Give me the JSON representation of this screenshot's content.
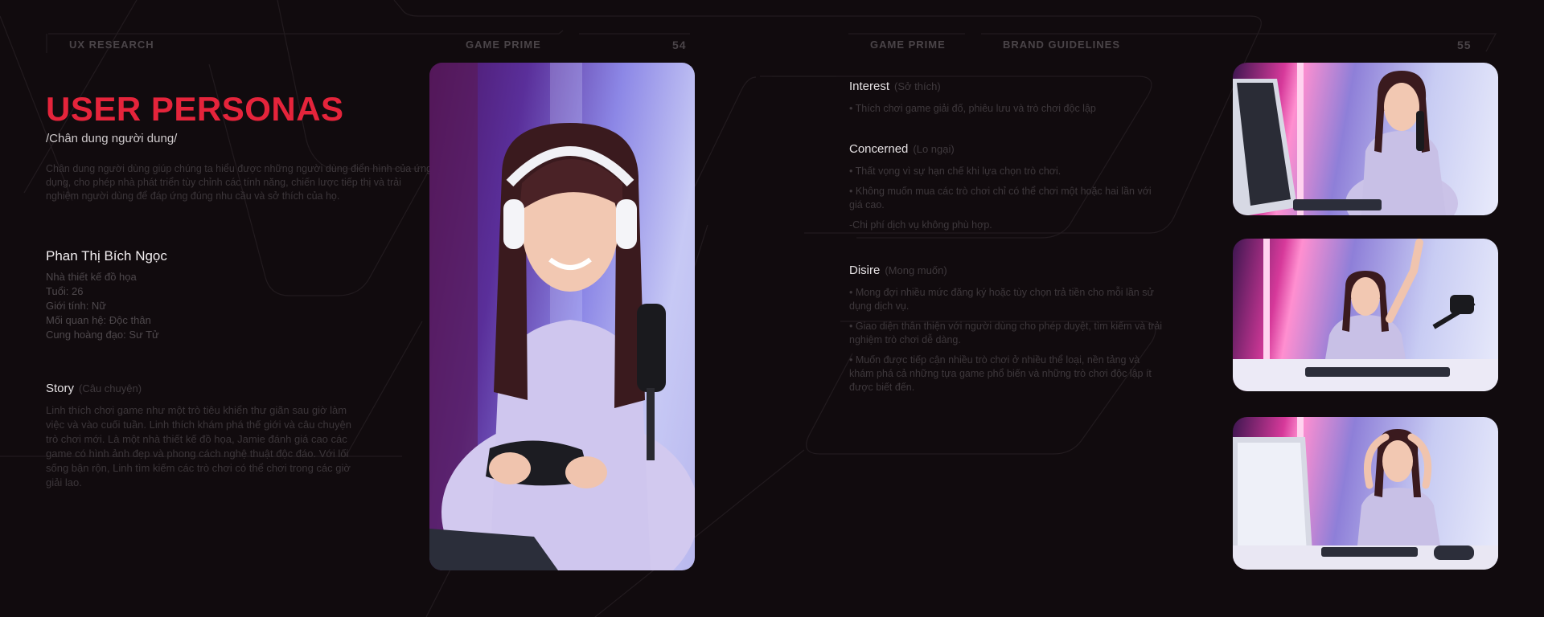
{
  "header": {
    "left_section": "UX RESEARCH",
    "left_brand": "GAME PRIME",
    "left_page": "54",
    "right_brand": "GAME PRIME",
    "right_section": "BRAND GUIDELINES",
    "right_page": "55"
  },
  "title": "USER PERSONAS",
  "subtitle": "/Chân dung người dung/",
  "intro": "Chân dung người dùng giúp chúng ta hiểu được những người dùng điển hình của ứng dụng, cho phép nhà phát triển tùy chỉnh các tính năng, chiến lược tiếp thị và trải nghiệm người dùng để đáp ứng đúng nhu cầu và sở thích của họ.",
  "persona": {
    "name": "Phan Thị Bích Ngọc",
    "details": [
      "Nhà thiết kế đồ họa",
      "Tuổi: 26",
      "Giới tính: Nữ",
      "Mối quan hệ: Độc thân",
      "Cung hoàng đạo: Sư Tử"
    ]
  },
  "story": {
    "label": "Story",
    "label_vi": "(Câu chuyện)",
    "text": "Linh thích chơi game như một trò tiêu khiển thư giãn sau giờ làm việc và vào cuối tuần. Linh thích khám phá thế giới và câu chuyện trò chơi mới. Là một nhà thiết kế đồ họa, Jamie đánh giá cao các game có hình ảnh đẹp và phong cách nghệ thuật độc đáo. Với lối sống bận rộn, Linh tìm kiếm các trò chơi có thể chơi trong các giờ giải lao."
  },
  "interest": {
    "label": "Interest",
    "label_vi": "(Sở thích)",
    "items": [
      "• Thích chơi game giải đố, phiêu lưu và trò chơi độc lập"
    ]
  },
  "concerned": {
    "label": "Concerned",
    "label_vi": "(Lo ngại)",
    "items": [
      "• Thất vọng vì sự hạn chế khi lựa chọn trò chơi.",
      "• Không muốn mua các trò chơi chỉ có thể chơi một hoặc hai lần với giá cao.",
      "-Chi phí dịch vụ không phù hợp."
    ]
  },
  "desire": {
    "label": "Disire",
    "label_vi": "(Mong muốn)",
    "items": [
      "• Mong đợi nhiều mức đăng ký hoặc tùy chọn trả tiền cho mỗi lần sử dụng dịch vụ.",
      "• Giao diện thân thiện với người dùng cho phép duyệt, tìm kiếm và trải nghiệm trò chơi dễ dàng.",
      "• Muốn được tiếp cận nhiều trò chơi ở nhiều thể loại, nền tảng và khám phá cả những tựa game phổ biến và những trò chơi độc lập ít được biết đến."
    ]
  },
  "colors": {
    "background": "#110b0e",
    "accent": "#e5243b"
  }
}
